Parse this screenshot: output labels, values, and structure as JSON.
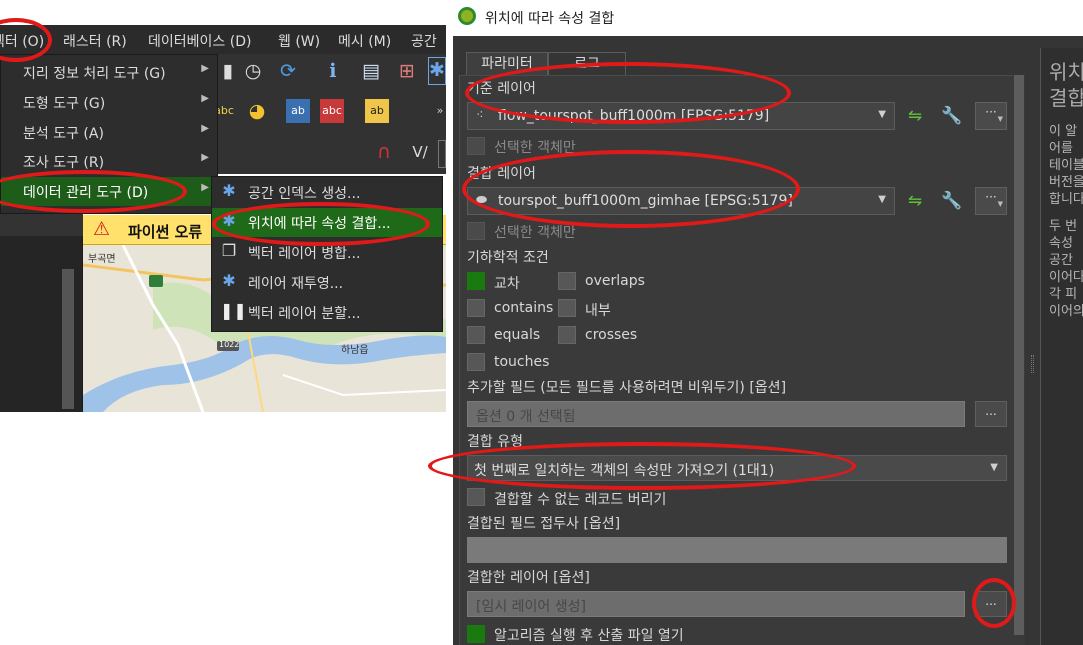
{
  "menubar": {
    "items": [
      "벡터 (O)",
      "래스터 (R)",
      "데이터베이스 (D)",
      "웹 (W)",
      "메시 (M)",
      "공간"
    ]
  },
  "vector_menu": {
    "items": [
      {
        "label": "지리 정보 처리 도구 (G)",
        "has_submenu": true
      },
      {
        "label": "도형 도구 (G)",
        "has_submenu": true
      },
      {
        "label": "분석 도구 (A)",
        "has_submenu": true
      },
      {
        "label": "조사 도구 (R)",
        "has_submenu": true
      },
      {
        "label": "데이터 관리 도구 (D)",
        "has_submenu": true,
        "highlighted": true
      }
    ]
  },
  "data_mgmt_submenu": {
    "items": [
      {
        "label": "공간 인덱스 생성...",
        "icon": "gear-icon"
      },
      {
        "label": "위치에 따라 속성 결합...",
        "icon": "gear-icon",
        "highlighted": true
      },
      {
        "label": "벡터 레이어 병합...",
        "icon": "merge-layers-icon"
      },
      {
        "label": "레이어 재투영...",
        "icon": "gear-icon"
      },
      {
        "label": "벡터 레이어 분할...",
        "icon": "split-layer-icon"
      }
    ]
  },
  "warning_bar": {
    "text": "파이썬 오류",
    "icon": "warning-icon"
  },
  "map": {
    "labels": [
      "부곡면",
      "하남읍",
      "1022"
    ]
  },
  "dialog": {
    "title": "위치에 따라 속성 결합",
    "tabs": [
      "파라미터",
      "로그"
    ],
    "active_tab": "파라미터",
    "base_layer": {
      "label": "기준 레이어",
      "value": "flow_tourspot_buff1000m [EPSG:5179]",
      "selected_only": "선택한 객체만"
    },
    "join_layer": {
      "label": "결합 레이어",
      "value": "tourspot_buff1000m_gimhae [EPSG:5179]",
      "selected_only": "선택한 객체만"
    },
    "geometric_predicate": {
      "label": "기하학적 조건",
      "options": [
        {
          "label": "교차",
          "checked": true
        },
        {
          "label": "overlaps",
          "checked": false
        },
        {
          "label": "contains",
          "checked": false
        },
        {
          "label": "내부",
          "checked": false
        },
        {
          "label": "equals",
          "checked": false
        },
        {
          "label": "crosses",
          "checked": false
        },
        {
          "label": "touches",
          "checked": false
        }
      ]
    },
    "fields_to_add": {
      "label": "추가할 필드 (모든 필드를 사용하려면 비워두기) [옵션]",
      "value": "옵션 0 개 선택됨",
      "button": "..."
    },
    "join_type": {
      "label": "결합 유형",
      "value": "첫 번째로 일치하는 객체의 속성만 가져오기 (1대1)"
    },
    "discard_records": {
      "label": "결합할 수 없는 레코드 버리기",
      "checked": false
    },
    "field_prefix": {
      "label": "결합된 필드 접두사 [옵션]",
      "value": ""
    },
    "output_layer": {
      "label": "결합한 레이어 [옵션]",
      "value": "[임시 레이어 생성]",
      "button": "..."
    },
    "open_after": {
      "label": "알고리즘 실행 후 산출 파일 열기",
      "checked": true
    }
  },
  "help_panel": {
    "title_lines": [
      "위치",
      "결합"
    ],
    "lines": [
      "이 알",
      "어를",
      "테이블",
      "버전을",
      "합니다",
      "",
      "두 번",
      "속성",
      "공간",
      "이어다",
      "각 피",
      "이어의"
    ]
  }
}
